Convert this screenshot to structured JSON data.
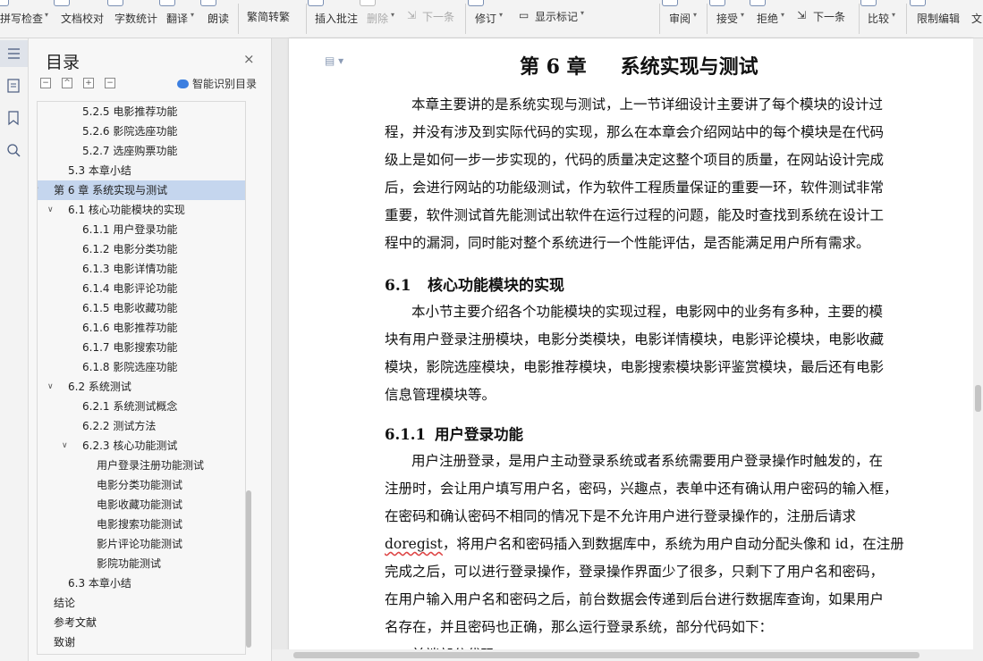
{
  "ribbon": {
    "items": [
      {
        "label": "拼写检查",
        "dropdown": true,
        "disabled": false
      },
      {
        "label": "文档校对",
        "dropdown": false,
        "disabled": false
      },
      {
        "label": "字数统计",
        "dropdown": false,
        "disabled": false
      },
      {
        "label": "翻译",
        "dropdown": true,
        "disabled": false
      },
      {
        "label": "朗读",
        "dropdown": false,
        "disabled": false
      },
      {
        "label": "繁简转繁",
        "dropdown": false,
        "disabled": false
      },
      {
        "label": "插入批注",
        "dropdown": false,
        "disabled": false
      },
      {
        "label": "删除",
        "dropdown": true,
        "disabled": true
      },
      {
        "label": "下一条",
        "dropdown": false,
        "disabled": true
      },
      {
        "label": "修订",
        "dropdown": true,
        "disabled": false
      },
      {
        "label": "显示标记",
        "dropdown": true,
        "disabled": false
      },
      {
        "label": "审阅",
        "dropdown": true,
        "disabled": false
      },
      {
        "label": "接受",
        "dropdown": true,
        "disabled": false
      },
      {
        "label": "拒绝",
        "dropdown": true,
        "disabled": false
      },
      {
        "label": "下一条",
        "dropdown": false,
        "disabled": false
      },
      {
        "label": "比较",
        "dropdown": true,
        "disabled": false
      },
      {
        "label": "限制编辑",
        "dropdown": false,
        "disabled": false
      },
      {
        "label": "文",
        "dropdown": false,
        "disabled": false
      }
    ]
  },
  "toc": {
    "title": "目录",
    "close": "×",
    "smart_label": "智能识别目录",
    "tools": [
      "−",
      "^",
      "+",
      "−"
    ],
    "items": [
      {
        "label": "5.2.5  电影推荐功能",
        "level": 3,
        "arrow": ""
      },
      {
        "label": "5.2.6  影院选座功能",
        "level": 3,
        "arrow": ""
      },
      {
        "label": "5.2.7  选座购票功能",
        "level": 3,
        "arrow": ""
      },
      {
        "label": "5.3  本章小结",
        "level": 2,
        "arrow": ""
      },
      {
        "label": "第 6 章  系统实现与测试",
        "level": 1,
        "arrow": "∨",
        "selected": true
      },
      {
        "label": "6.1  核心功能模块的实现",
        "level": 2,
        "arrow": "∨"
      },
      {
        "label": "6.1.1  用户登录功能",
        "level": 3,
        "arrow": ""
      },
      {
        "label": "6.1.2  电影分类功能",
        "level": 3,
        "arrow": ""
      },
      {
        "label": "6.1.3  电影详情功能",
        "level": 3,
        "arrow": ""
      },
      {
        "label": "6.1.4  电影评论功能",
        "level": 3,
        "arrow": ""
      },
      {
        "label": "6.1.5  电影收藏功能",
        "level": 3,
        "arrow": ""
      },
      {
        "label": "6.1.6  电影推荐功能",
        "level": 3,
        "arrow": ""
      },
      {
        "label": "6.1.7  电影搜索功能",
        "level": 3,
        "arrow": ""
      },
      {
        "label": "6.1.8  影院选座功能",
        "level": 3,
        "arrow": ""
      },
      {
        "label": "6.2  系统测试",
        "level": 2,
        "arrow": "∨"
      },
      {
        "label": "6.2.1  系统测试概念",
        "level": 3,
        "arrow": ""
      },
      {
        "label": "6.2.2  测试方法",
        "level": 3,
        "arrow": ""
      },
      {
        "label": "6.2.3  核心功能测试",
        "level": 3,
        "arrow": "∨"
      },
      {
        "label": "用户登录注册功能测试",
        "level": 4,
        "arrow": ""
      },
      {
        "label": "电影分类功能测试",
        "level": 4,
        "arrow": ""
      },
      {
        "label": "电影收藏功能测试",
        "level": 4,
        "arrow": ""
      },
      {
        "label": "电影搜索功能测试",
        "level": 4,
        "arrow": ""
      },
      {
        "label": "影片评论功能测试",
        "level": 4,
        "arrow": ""
      },
      {
        "label": "影院功能测试",
        "level": 4,
        "arrow": ""
      },
      {
        "label": "6.3  本章小结",
        "level": 2,
        "arrow": ""
      },
      {
        "label": "结论",
        "level": 1,
        "arrow": ""
      },
      {
        "label": "参考文献",
        "level": 1,
        "arrow": ""
      },
      {
        "label": "致谢",
        "level": 1,
        "arrow": ""
      }
    ]
  },
  "doc": {
    "chapter_num": "第 6 章",
    "chapter_title": "系统实现与测试",
    "intro_lines": [
      "本章主要讲的是系统实现与测试，上一节详细设计主要讲了每个模块的设计过",
      "程，并没有涉及到实际代码的实现，那么在本章会介绍网站中的每个模块是在代码",
      "级上是如何一步一步实现的，代码的质量决定这整个项目的质量，在网站设计完成",
      "后，会进行网站的功能级测试，作为软件工程质量保证的重要一环，软件测试非常",
      "重要，软件测试首先能测试出软件在运行过程的问题，能及时查找到系统在设计工",
      "程中的漏洞，同时能对整个系统进行一个性能评估，是否能满足用户所有需求。"
    ],
    "s61_num": "6.1",
    "s61_title": "核心功能模块的实现",
    "s61_lines": [
      "本小节主要介绍各个功能模块的实现过程，电影网中的业务有多种，主要的模",
      "块有用户登录注册模块，电影分类模块，电影详情模块，电影评论模块，电影收藏",
      "模块，影院选座模块，电影推荐模块，电影搜索模块影评鉴赏模块，最后还有电影",
      "信息管理模块等。"
    ],
    "s611_num": "6.1.1",
    "s611_title": "用户登录功能",
    "s611_lines": [
      "用户注册登录，是用户主动登录系统或者系统需要用户登录操作时触发的，在",
      "注册时，会让用户填写用户名，密码，兴趣点，表单中还有确认用户密码的输入框，",
      "在密码和确认密码不相同的情况下是不允许用户进行登录操作的，注册后请求",
      "doregist",
      "，将用户名和密码插入到数据库中，系统为用户自动分配头像和 id，在注册",
      "完成之后，可以进行登录操作，登录操作界面少了很多，只剩下了用户名和密码，",
      "在用户输入用户名和密码之后，前台数据会传递到后台进行数据库查询，如果用户",
      "名存在，并且密码也正确，那么运行登录系统，部分代码如下：",
      "前端部分代码"
    ]
  }
}
